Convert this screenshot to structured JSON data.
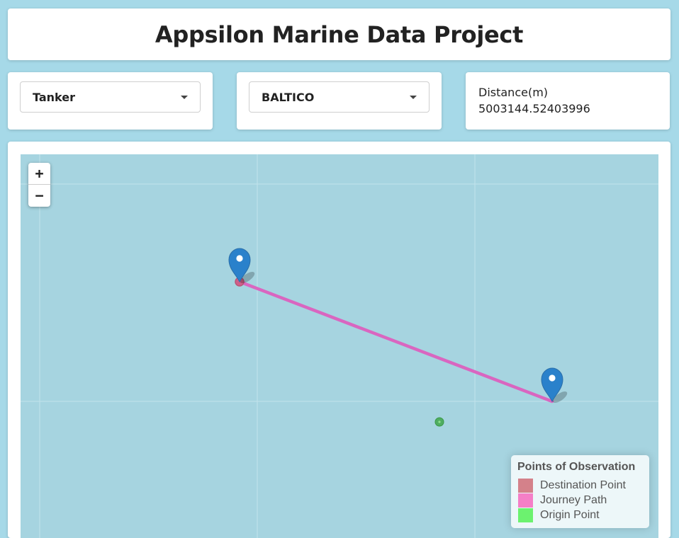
{
  "header": {
    "title": "Appsilon Marine Data Project"
  },
  "filters": {
    "vessel_type": {
      "selected": "Tanker"
    },
    "vessel_name": {
      "selected": "BALTICO"
    }
  },
  "distance": {
    "label": "Distance(m)",
    "value": "5003144.52403996"
  },
  "map": {
    "zoom_in_label": "+",
    "zoom_out_label": "−",
    "legend": {
      "title": "Points of Observation",
      "items": [
        {
          "label": "Destination Point",
          "color": "#d4818a"
        },
        {
          "label": "Journey Path",
          "color": "#f57fc7"
        },
        {
          "label": "Origin Point",
          "color": "#6cf26f"
        }
      ]
    },
    "colors": {
      "water": "#a6d4e0",
      "path": "#d966c0",
      "marker": "#2a81cb",
      "origin_dot": "#3fa64b"
    }
  }
}
